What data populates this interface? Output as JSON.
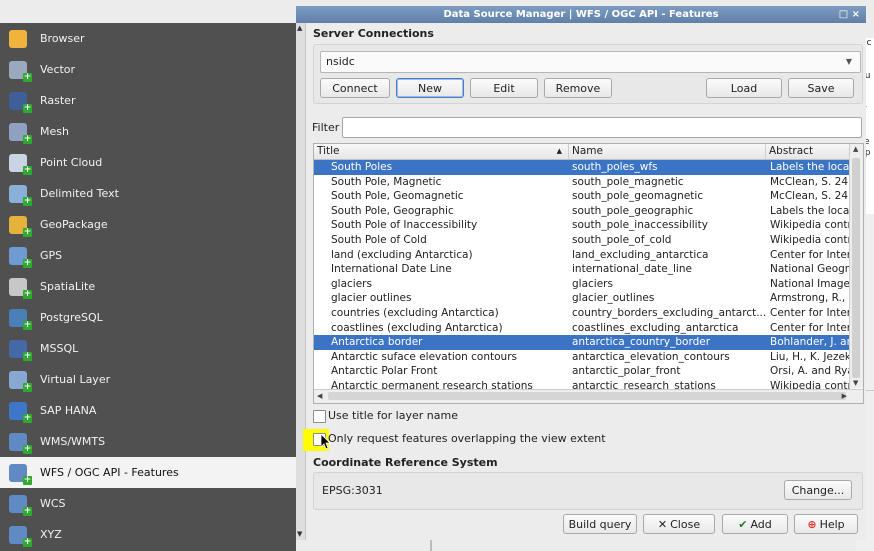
{
  "window": {
    "title": "Data Source Manager | WFS / OGC API - Features",
    "controls": "□ ×"
  },
  "sidebar": {
    "items": [
      {
        "label": "Browser",
        "icon": "folder-icon",
        "color": "#f0b43c"
      },
      {
        "label": "Vector",
        "icon": "vector-icon",
        "color": "#9aa9bd"
      },
      {
        "label": "Raster",
        "icon": "raster-icon",
        "color": "#3e5f98"
      },
      {
        "label": "Mesh",
        "icon": "mesh-icon",
        "color": "#8fa0c0"
      },
      {
        "label": "Point Cloud",
        "icon": "point-cloud-icon",
        "color": "#c8d3e4"
      },
      {
        "label": "Delimited Text",
        "icon": "delimited-text-icon",
        "color": "#8bb0d8"
      },
      {
        "label": "GeoPackage",
        "icon": "geopackage-icon",
        "color": "#e5b33c"
      },
      {
        "label": "GPS",
        "icon": "gps-icon",
        "color": "#6f9ad2"
      },
      {
        "label": "SpatiaLite",
        "icon": "spatialite-icon",
        "color": "#c7c7c7"
      },
      {
        "label": "PostgreSQL",
        "icon": "postgresql-icon",
        "color": "#4a80b8"
      },
      {
        "label": "MSSQL",
        "icon": "mssql-icon",
        "color": "#4569a8"
      },
      {
        "label": "Virtual Layer",
        "icon": "virtual-layer-icon",
        "color": "#88a8d4"
      },
      {
        "label": "SAP HANA",
        "icon": "sap-hana-icon",
        "color": "#3f77c8"
      },
      {
        "label": "WMS/WMTS",
        "icon": "wms-icon",
        "color": "#5f8ac4"
      },
      {
        "label": "WFS / OGC API - Features",
        "icon": "wfs-icon",
        "color": "#5f8ac4",
        "selected": true
      },
      {
        "label": "WCS",
        "icon": "wcs-icon",
        "color": "#5f8ac4"
      },
      {
        "label": "XYZ",
        "icon": "xyz-icon",
        "color": "#5f8ac4"
      }
    ]
  },
  "server": {
    "group_title": "Server Connections",
    "connection": "nsidc",
    "buttons": {
      "connect": "Connect",
      "new": "New",
      "edit": "Edit",
      "remove": "Remove",
      "load": "Load",
      "save": "Save"
    }
  },
  "filter": {
    "label": "Filter",
    "value": ""
  },
  "table": {
    "columns": [
      "Title",
      "Name",
      "Abstract"
    ],
    "sort_indicator": "▲",
    "rows": [
      {
        "title": "South Poles",
        "name": "south_poles_wfs",
        "abstract": "Labels the locat",
        "selected": true
      },
      {
        "title": "South Pole, Magnetic",
        "name": "south_pole_magnetic",
        "abstract": "McClean, S. 24"
      },
      {
        "title": "South Pole, Geomagnetic",
        "name": "south_pole_geomagnetic",
        "abstract": "McClean, S. 24"
      },
      {
        "title": "South Pole, Geographic",
        "name": "south_pole_geographic",
        "abstract": "Labels the locat"
      },
      {
        "title": "South Pole of Inaccessibility",
        "name": "south_pole_inaccessibility",
        "abstract": "Wikipedia contr"
      },
      {
        "title": "South Pole of Cold",
        "name": "south_pole_of_cold",
        "abstract": "Wikipedia contr"
      },
      {
        "title": "land (excluding Antarctica)",
        "name": "land_excluding_antarctica",
        "abstract": "Center for Inter"
      },
      {
        "title": "International Date Line",
        "name": "international_date_line",
        "abstract": "National Geogra"
      },
      {
        "title": "glaciers",
        "name": "glaciers",
        "abstract": "National Imager"
      },
      {
        "title": "glacier outlines",
        "name": "glacier_outlines",
        "abstract": "Armstrong, R., E"
      },
      {
        "title": "countries (excluding Antarctica)",
        "name": "country_borders_excluding_antarct...",
        "abstract": "Center for Inter"
      },
      {
        "title": "coastlines (excluding Antarctica)",
        "name": "coastlines_excluding_antarctica",
        "abstract": "Center for Inter"
      },
      {
        "title": "Antarctica border",
        "name": "antarctica_country_border",
        "abstract": "Bohlander, J. an",
        "selected": true
      },
      {
        "title": "Antarctic suface elevation contours",
        "name": "antarctica_elevation_contours",
        "abstract": "Liu, H., K. Jezek"
      },
      {
        "title": "Antarctic Polar Front",
        "name": "antarctic_polar_front",
        "abstract": "Orsi, A. and Rya"
      },
      {
        "title": "Antarctic permanent research stations",
        "name": "antarctic_research_stations",
        "abstract": "Wikipedia contr"
      }
    ]
  },
  "options": {
    "use_title": "Use title for layer name",
    "only_request": "Only request features overlapping the view extent"
  },
  "crs": {
    "group_title": "Coordinate Reference System",
    "value": "EPSG:3031",
    "change": "Change..."
  },
  "footer": {
    "build_query": "Build query",
    "close": "Close",
    "add": "Add",
    "help": "Help"
  },
  "background_text": [
    "s c",
    "t",
    "a",
    "hu",
    "e",
    "a",
    "ly",
    "c",
    "",
    "r",
    "ce",
    "up",
    "e"
  ]
}
